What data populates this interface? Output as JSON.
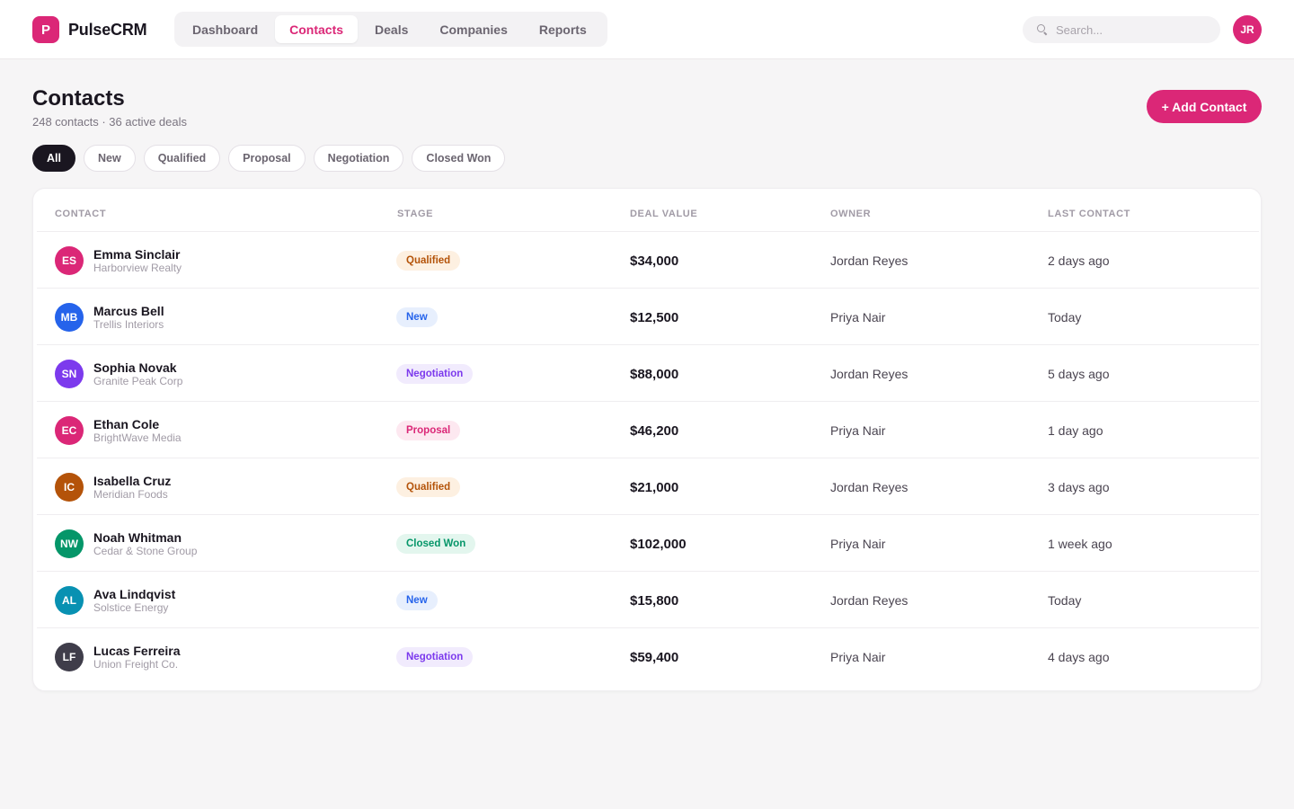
{
  "brand": {
    "logo_letter": "P",
    "name": "PulseCRM"
  },
  "nav": {
    "tabs": [
      {
        "label": "Dashboard",
        "active": false
      },
      {
        "label": "Contacts",
        "active": true
      },
      {
        "label": "Deals",
        "active": false
      },
      {
        "label": "Companies",
        "active": false
      },
      {
        "label": "Reports",
        "active": false
      }
    ]
  },
  "search": {
    "placeholder": "Search...",
    "value": ""
  },
  "user": {
    "initials": "JR"
  },
  "page": {
    "title": "Contacts",
    "subtitle": "248 contacts · 36 active deals",
    "add_button": "+ Add Contact"
  },
  "filters": [
    {
      "label": "All",
      "active": true
    },
    {
      "label": "New",
      "active": false
    },
    {
      "label": "Qualified",
      "active": false
    },
    {
      "label": "Proposal",
      "active": false
    },
    {
      "label": "Negotiation",
      "active": false
    },
    {
      "label": "Closed Won",
      "active": false
    }
  ],
  "table": {
    "columns": {
      "contact": "CONTACT",
      "stage": "STAGE",
      "deal_value": "DEAL VALUE",
      "owner": "OWNER",
      "last_contact": "LAST CONTACT"
    },
    "rows": [
      {
        "initials": "ES",
        "avatar_color": "#db2777",
        "name": "Emma Sinclair",
        "company": "Harborview Realty",
        "stage": "Qualified",
        "deal_value": "$34,000",
        "owner": "Jordan Reyes",
        "last_contact": "2 days ago"
      },
      {
        "initials": "MB",
        "avatar_color": "#2563eb",
        "name": "Marcus Bell",
        "company": "Trellis Interiors",
        "stage": "New",
        "deal_value": "$12,500",
        "owner": "Priya Nair",
        "last_contact": "Today"
      },
      {
        "initials": "SN",
        "avatar_color": "#7c3aed",
        "name": "Sophia Novak",
        "company": "Granite Peak Corp",
        "stage": "Negotiation",
        "deal_value": "$88,000",
        "owner": "Jordan Reyes",
        "last_contact": "5 days ago"
      },
      {
        "initials": "EC",
        "avatar_color": "#db2777",
        "name": "Ethan Cole",
        "company": "BrightWave Media",
        "stage": "Proposal",
        "deal_value": "$46,200",
        "owner": "Priya Nair",
        "last_contact": "1 day ago"
      },
      {
        "initials": "IC",
        "avatar_color": "#b45309",
        "name": "Isabella Cruz",
        "company": "Meridian Foods",
        "stage": "Qualified",
        "deal_value": "$21,000",
        "owner": "Jordan Reyes",
        "last_contact": "3 days ago"
      },
      {
        "initials": "NW",
        "avatar_color": "#059669",
        "name": "Noah Whitman",
        "company": "Cedar & Stone Group",
        "stage": "Closed Won",
        "deal_value": "$102,000",
        "owner": "Priya Nair",
        "last_contact": "1 week ago"
      },
      {
        "initials": "AL",
        "avatar_color": "#0891b2",
        "name": "Ava Lindqvist",
        "company": "Solstice Energy",
        "stage": "New",
        "deal_value": "$15,800",
        "owner": "Jordan Reyes",
        "last_contact": "Today"
      },
      {
        "initials": "LF",
        "avatar_color": "#3f3d4a",
        "name": "Lucas Ferreira",
        "company": "Union Freight Co.",
        "stage": "Negotiation",
        "deal_value": "$59,400",
        "owner": "Priya Nair",
        "last_contact": "4 days ago"
      }
    ]
  },
  "stage_colors": {
    "Qualified": {
      "bg": "#fdf0e1",
      "fg": "#b45309"
    },
    "New": {
      "bg": "#e7effd",
      "fg": "#2563eb"
    },
    "Negotiation": {
      "bg": "#f1ebfd",
      "fg": "#7c3aed"
    },
    "Proposal": {
      "bg": "#fde8f0",
      "fg": "#db2777"
    },
    "Closed Won": {
      "bg": "#e3f6ee",
      "fg": "#059669"
    }
  }
}
